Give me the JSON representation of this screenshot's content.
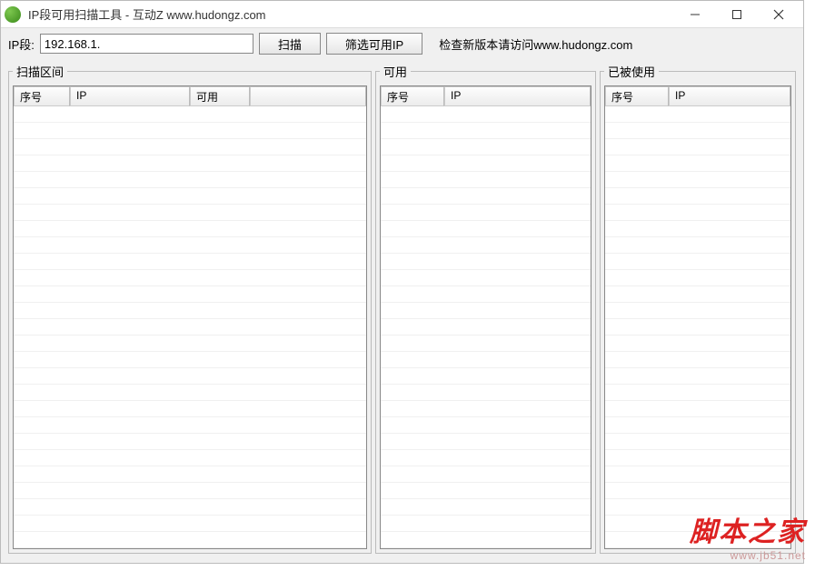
{
  "window": {
    "title": "IP段可用扫描工具  -  互动Z www.hudongz.com"
  },
  "toolbar": {
    "ip_label": "IP段:",
    "ip_value": "192.168.1.",
    "scan_label": "扫描",
    "filter_label": "筛选可用IP",
    "version_text": "检查新版本请访问www.hudongz.com"
  },
  "groups": {
    "scan": {
      "legend": "扫描区间",
      "columns": [
        "序号",
        "IP",
        "可用",
        ""
      ]
    },
    "available": {
      "legend": "可用",
      "columns": [
        "序号",
        "IP"
      ]
    },
    "used": {
      "legend": "已被使用",
      "columns": [
        "序号",
        "IP"
      ]
    }
  },
  "watermark": {
    "main": "脚本之家",
    "sub": "www.jb51.net"
  }
}
